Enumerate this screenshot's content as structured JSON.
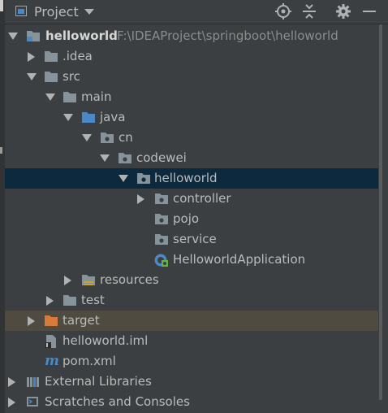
{
  "header": {
    "title": "Project",
    "icons": [
      "locate-icon",
      "collapse-all-icon",
      "settings-gear-icon",
      "hide-minimize-icon"
    ]
  },
  "tree": [
    {
      "label": "helloworld",
      "path": "F:\\IDEAProject\\springboot\\helloworld",
      "icon": "module-folder-icon",
      "expanded": true
    },
    {
      "label": ".idea",
      "icon": "folder-icon",
      "expanded": false
    },
    {
      "label": "src",
      "icon": "folder-icon",
      "expanded": true
    },
    {
      "label": "main",
      "icon": "folder-icon",
      "expanded": true
    },
    {
      "label": "java",
      "icon": "source-root-folder-icon",
      "expanded": true
    },
    {
      "label": "cn",
      "icon": "package-icon",
      "expanded": true
    },
    {
      "label": "codewei",
      "icon": "package-icon",
      "expanded": true
    },
    {
      "label": "helloworld",
      "icon": "package-icon",
      "expanded": true,
      "selected": true
    },
    {
      "label": "controller",
      "icon": "package-icon",
      "expanded": false
    },
    {
      "label": "pojo",
      "icon": "package-icon"
    },
    {
      "label": "service",
      "icon": "package-icon"
    },
    {
      "label": "HelloworldApplication",
      "icon": "spring-boot-class-icon"
    },
    {
      "label": "resources",
      "icon": "resources-root-folder-icon",
      "expanded": false
    },
    {
      "label": "test",
      "icon": "folder-icon",
      "expanded": false
    },
    {
      "label": "target",
      "icon": "excluded-folder-icon",
      "expanded": false,
      "excluded": true
    },
    {
      "label": "helloworld.iml",
      "icon": "iml-file-icon"
    },
    {
      "label": "pom.xml",
      "icon": "maven-pom-icon"
    },
    {
      "label": "External Libraries",
      "icon": "libraries-icon",
      "expanded": false
    },
    {
      "label": "Scratches and Consoles",
      "icon": "scratches-icon",
      "expanded": false
    }
  ],
  "colors": {
    "background": "#3c3f41",
    "selection": "#0d293e",
    "excluded_row": "#4f4b41",
    "folder": "#87939a",
    "source_root": "#4a88c7",
    "excluded_folder": "#d87a3b",
    "text": "#bbbbbb"
  }
}
